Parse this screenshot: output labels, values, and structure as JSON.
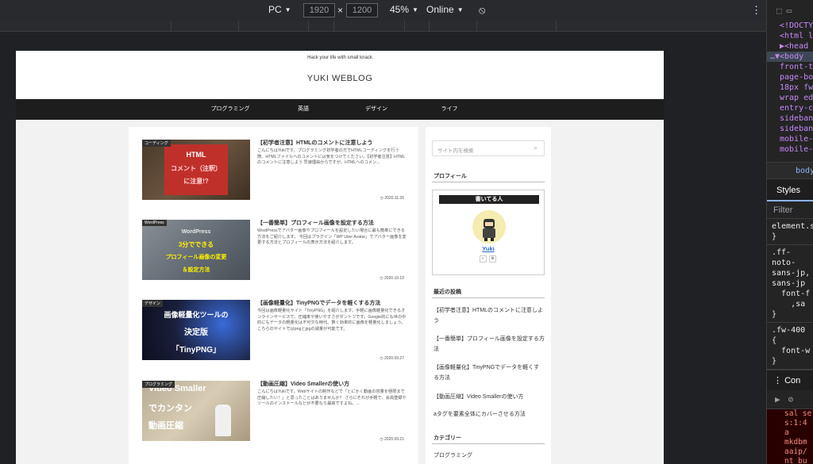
{
  "toolbar": {
    "device": "PC",
    "width": "1920",
    "times": "×",
    "height": "1200",
    "zoom": "45%",
    "network": "Online",
    "rotate_icon": "rotate-icon",
    "more_icon": "more-vertical-icon"
  },
  "site": {
    "tagline": "Hack your life with small knack",
    "title": "YUKI WEBLOG",
    "nav": [
      "プログラミング",
      "英語",
      "デザイン",
      "ライフ"
    ]
  },
  "posts": [
    {
      "category": "コーディング",
      "thumb_lines": [
        "HTML",
        "コメント（注釈）",
        "に注意!?"
      ],
      "title": "【初学者注意】HTMLのコメントに注意しよう",
      "excerpt": "こんにちはYukiです。プログラミング初学者の方でHTMLコーディングを行う際、HTMLファイルへのコメントには気をつけてください。【初学者注意】HTMLのコメントに注意しよう 早速理由からですが、HTMLへのコメン...",
      "date": "2020.11.26"
    },
    {
      "category": "WordPress",
      "thumb_lines": [
        "WordPress",
        "3分でできる",
        "プロフィール画像の変更",
        "＆設定方法"
      ],
      "title": "【一番簡単】プロフィール画像を設定する方法",
      "excerpt": "WordPressでアバター画像やプロフィールを設定したい場合に最も簡単にできる方法をご紹介します。 今回はプラグイン「WP User Avatar」でアバター画像を変更する方法とプロフィールの表示方法を紹介します。",
      "date": "2020.10.10"
    },
    {
      "category": "デザイン",
      "thumb_lines": [
        "画像軽量化ツールの",
        "決定版",
        "「TinyPNG」"
      ],
      "title": "【画像軽量化】TinyPNGでデータを軽くする方法",
      "excerpt": "今回は画像軽量化サイト「TinyPNG」を紹介します。手軽に画像軽量化できるオンラインサービスで、圧縮率や使いやすさがダントツです。Google的にも世の中的にもデータの軽量化は不可欠な時代。賢く効率的に画像を軽量化しましょう。こちらのサイトではpngとjpgの減量が可能です。",
      "date": "2020.09.27"
    },
    {
      "category": "プログラミング",
      "thumb_lines": [
        "Video Smaller",
        "でカンタン",
        "動画圧縮"
      ],
      "title": "【動画圧縮】Video Smallerの使い方",
      "excerpt": "こんにちはYukiです。Webサイトの制作などで「とにかく動画の容量を極限まで圧縮したい！」と思ったことはありませんか？ さらにそれが手軽で、会員登録やツールのインストールなどが不要なら最高ですよね。...",
      "date": "2020.09.21"
    }
  ],
  "sidebar": {
    "search_placeholder": "サイト内を検索",
    "profile_heading": "プロフィール",
    "profile_box_title": "書いてる人",
    "profile_name": "Yuki",
    "recent_heading": "最近の投稿",
    "recent": [
      "【初学者注意】HTMLのコメントに注意しよう",
      "【一番簡単】プロフィール画像を設定する方法",
      "【画像軽量化】TinyPNGでデータを軽くする方法",
      "【動画圧縮】Video Smallerの使い方",
      "aタグを要素全体にカバーさせる方法"
    ],
    "category_heading": "カテゴリー",
    "category_first": "プログラミング"
  },
  "devtools": {
    "elements": [
      "<!DOCTY",
      "<html l",
      "▶<head",
      "…▼<body",
      "front-t",
      "page-bo",
      "18px fw",
      "wrap ed",
      "entry-c",
      "sideban",
      "sideban",
      "mobile-",
      "mobile-"
    ],
    "breadcrumb": "body",
    "styles_tab": "Styles",
    "filter": "Filter",
    "css": [
      "element.s",
      "}",
      ".ff-",
      "noto-",
      "sans-jp,",
      "sans-jp",
      "  font-f",
      "    ,sa",
      "}",
      ".fw-400",
      "{",
      "  font-w",
      "}"
    ],
    "console_tab": "Con",
    "console_lines": [
      "sal se",
      "s:1:4",
      "   a",
      "mkdbm",
      "aaip/",
      "nt_bu"
    ]
  }
}
